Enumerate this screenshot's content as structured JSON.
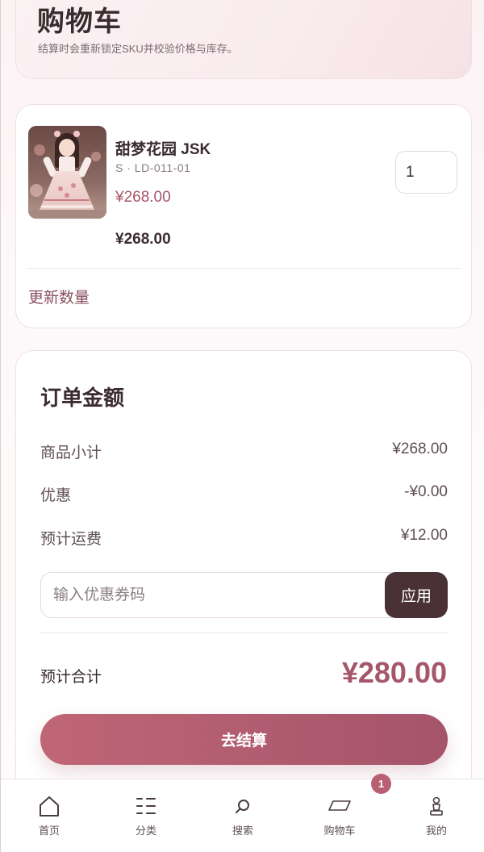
{
  "header": {
    "title": "购物车",
    "subtitle": "结算时会重新锁定SKU并校验价格与库存。"
  },
  "cart": {
    "items": [
      {
        "name": "甜梦花园 JSK",
        "sku": "S · LD-011-01",
        "price": "¥268.00",
        "line_total": "¥268.00",
        "quantity": "1",
        "image": "lolita-dress-photo"
      }
    ],
    "update_label": "更新数量"
  },
  "summary": {
    "title": "订单金额",
    "rows": [
      {
        "label": "商品小计",
        "value": "¥268.00"
      },
      {
        "label": "优惠",
        "value": "-¥0.00"
      },
      {
        "label": "预计运费",
        "value": "¥12.00"
      }
    ],
    "coupon_placeholder": "输入优惠券码",
    "apply_label": "应用",
    "total_label": "预计合计",
    "total_value": "¥280.00",
    "checkout_label": "去结算"
  },
  "nav": {
    "items": [
      {
        "label": "首页",
        "icon": "home-icon"
      },
      {
        "label": "分类",
        "icon": "category-icon"
      },
      {
        "label": "搜索",
        "icon": "search-icon"
      },
      {
        "label": "购物车",
        "icon": "cart-icon"
      },
      {
        "label": "我的",
        "icon": "profile-icon"
      }
    ],
    "cart_badge": "1"
  },
  "colors": {
    "accent": "#a5566a",
    "dark_button": "#4a3136",
    "checkout_gradient_start": "#bf6676",
    "checkout_gradient_end": "#a5546a"
  }
}
